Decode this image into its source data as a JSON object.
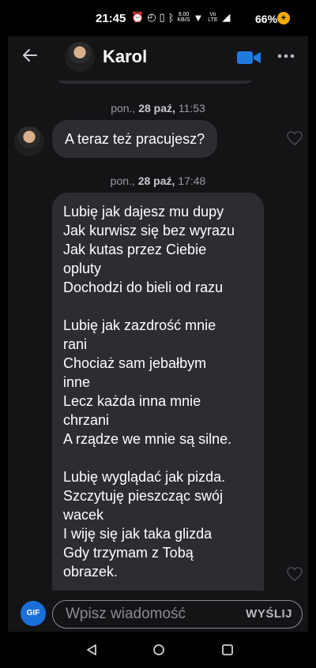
{
  "status_bar": {
    "time": "21:45",
    "network_speed_value": "9.00",
    "network_speed_unit": "KB/S",
    "volte_label": "Vo LTE",
    "battery": "66%"
  },
  "header": {
    "contact_name": "Karol"
  },
  "messages": {
    "timestamp1_day": "pon.,",
    "timestamp1_date": "28 paź,",
    "timestamp1_time": "11:53",
    "message1": "A teraz też pracujesz?",
    "timestamp2_day": "pon.,",
    "timestamp2_date": "28 paź,",
    "timestamp2_time": "17:48",
    "message2_lines": [
      "Lubię jak dajesz mu dupy",
      "Jak kurwisz się bez wyrazu",
      "Jak kutas przez Ciebie",
      "opluty",
      "Dochodzi do bieli od razu",
      "",
      "Lubię jak zazdrość mnie",
      "rani",
      "Chociaż sam jebałbym",
      "inne",
      "Lecz każda inna mnie",
      "chrzani",
      "A rządze we mnie są silne.",
      "",
      "Lubię wyglądać jak pizda.",
      "Szczytuję pieszcząc swój",
      "wacek",
      "I wiję się jak taka glizda",
      "Gdy trzymam z Tobą",
      "obrazek."
    ]
  },
  "composer": {
    "gif_label": "GIF",
    "placeholder": "Wpisz wiadomość",
    "send_label": "WYŚLIJ"
  },
  "colors": {
    "background": "#141417",
    "bubble": "#2c2c33",
    "accent": "#1a6fd8"
  }
}
